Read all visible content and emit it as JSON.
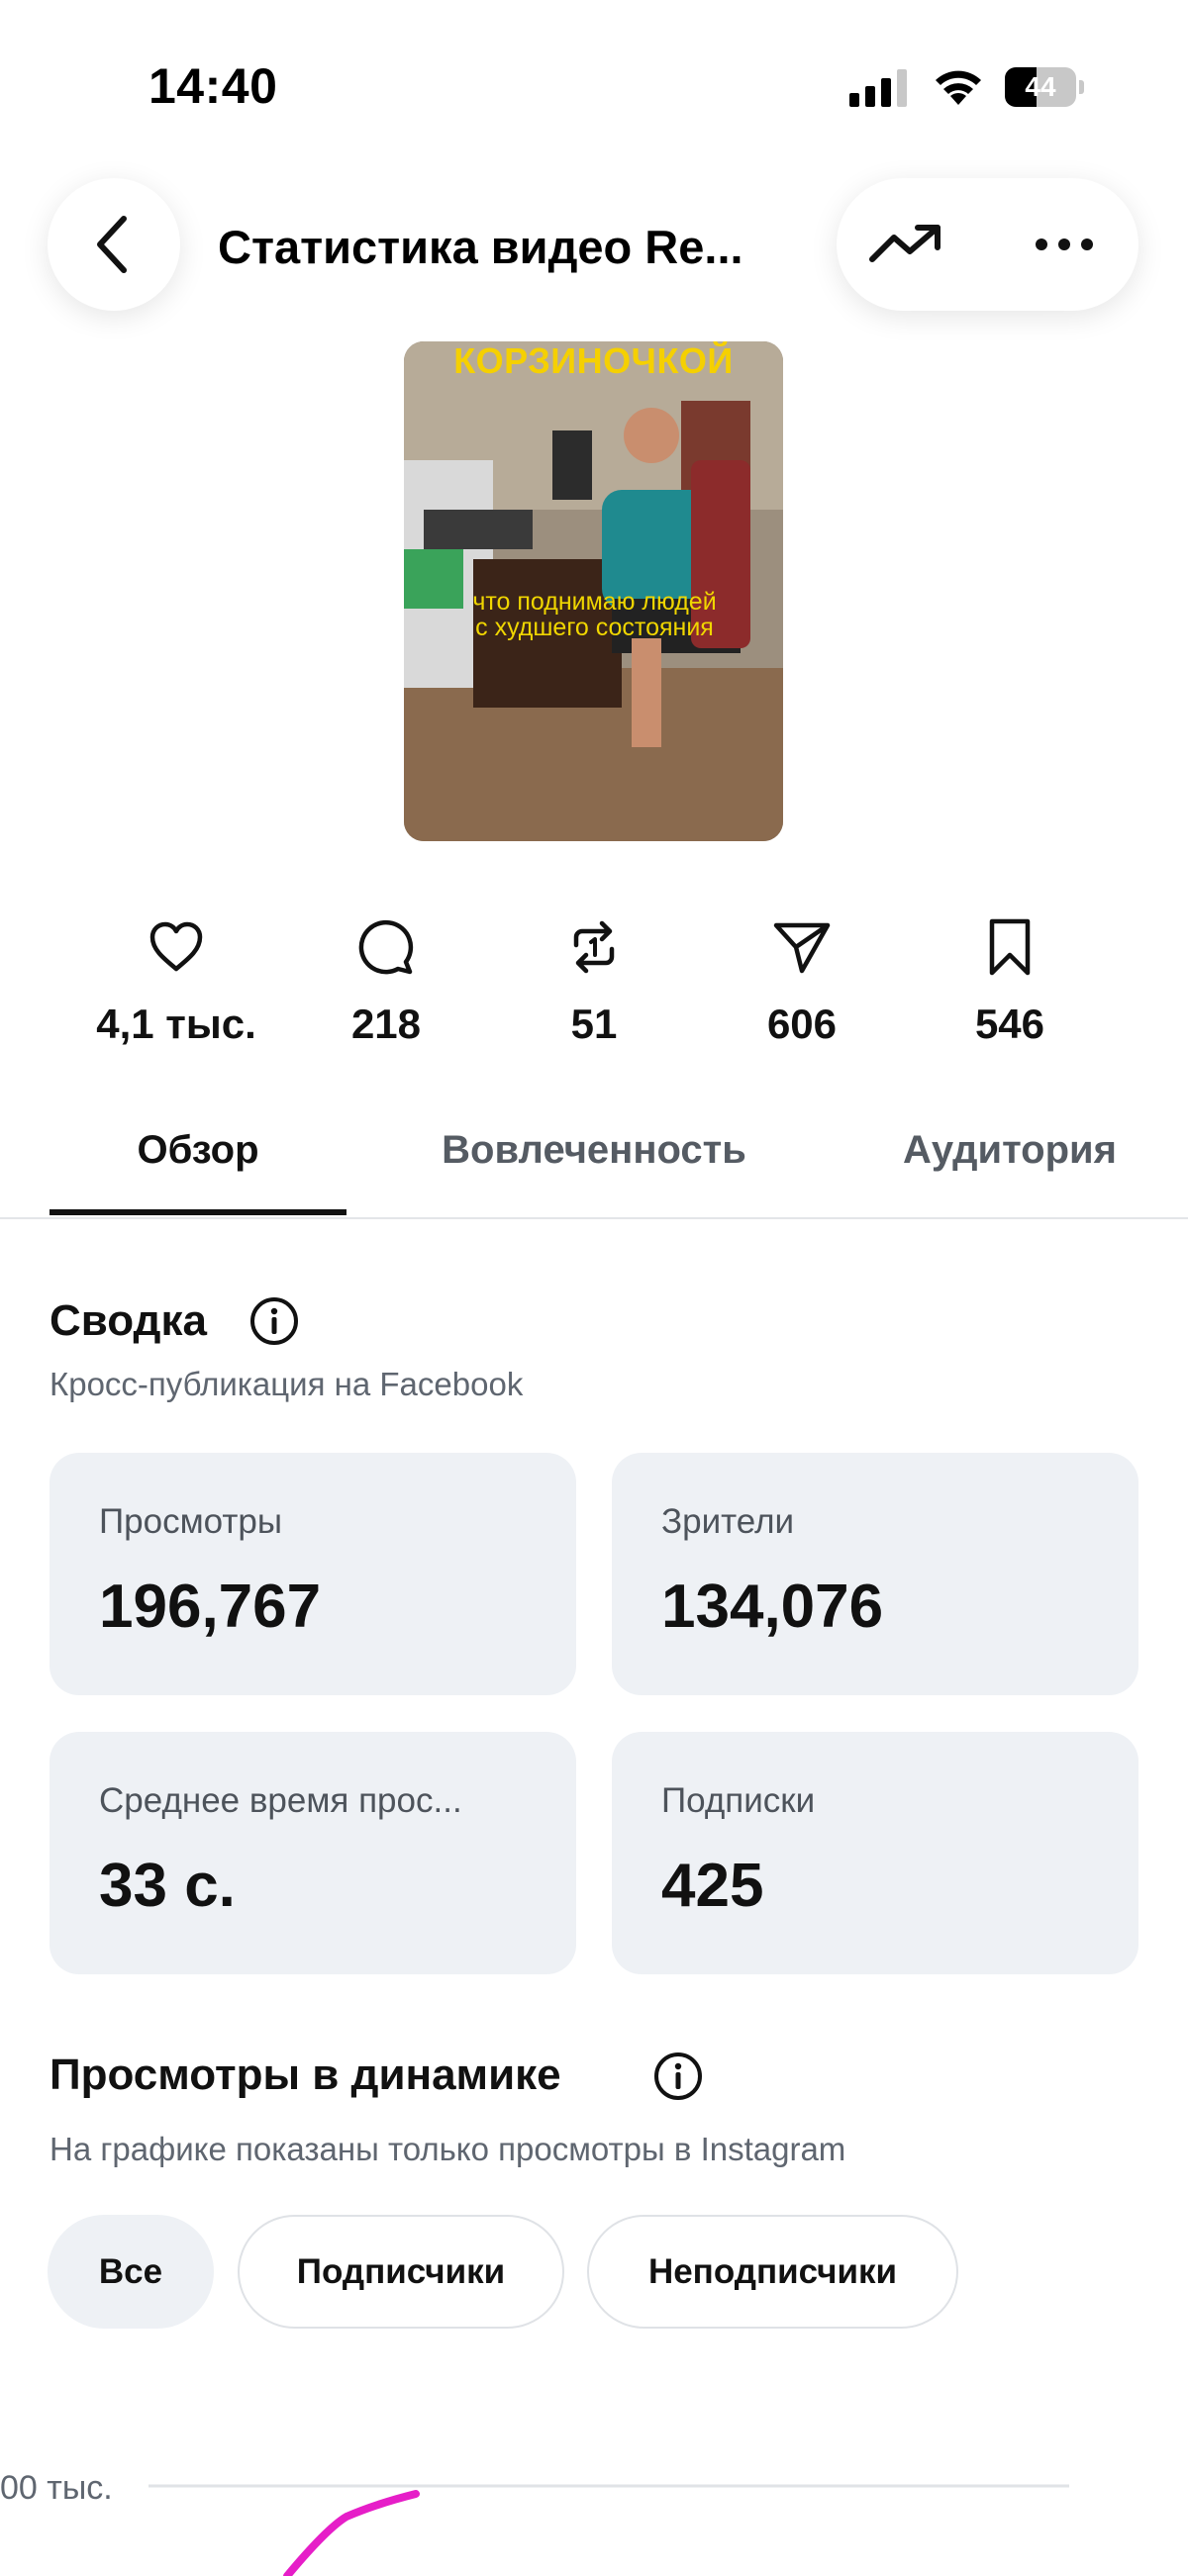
{
  "status_bar": {
    "time": "14:40",
    "battery_percent": "44",
    "battery_level": 0.44,
    "icons": [
      "cellular-signal-icon",
      "wifi-icon",
      "battery-icon"
    ]
  },
  "header": {
    "title": "Статистика видео Re...",
    "back_icon": "chevron-left-icon",
    "trend_icon": "trending-up-icon",
    "more_icon": "more-horizontal-icon"
  },
  "video": {
    "caption_top": "КОРЗИНОЧКОЙ",
    "caption_middle": "что поднимаю людей с худшего состояния"
  },
  "stats": [
    {
      "icon": "heart-icon",
      "value": "4,1 тыс."
    },
    {
      "icon": "comment-icon",
      "value": "218"
    },
    {
      "icon": "repost-icon",
      "value": "51"
    },
    {
      "icon": "send-icon",
      "value": "606"
    },
    {
      "icon": "bookmark-icon",
      "value": "546"
    }
  ],
  "tabs": [
    {
      "label": "Обзор",
      "active": true
    },
    {
      "label": "Вовлеченность",
      "active": false
    },
    {
      "label": "Аудитория",
      "active": false
    }
  ],
  "summary": {
    "title": "Сводка",
    "subtitle": "Кросс-публикация на Facebook",
    "cards": [
      {
        "label": "Просмотры",
        "value": "196,767"
      },
      {
        "label": "Зрители",
        "value": "134,076"
      },
      {
        "label": "Среднее время прос...",
        "value": "33 с."
      },
      {
        "label": "Подписки",
        "value": "425"
      }
    ]
  },
  "views_dynamics": {
    "title": "Просмотры в динамике",
    "subtitle": "На графике показаны только просмотры в Instagram",
    "filters": [
      {
        "label": "Все",
        "active": true
      },
      {
        "label": "Подписчики",
        "active": false
      },
      {
        "label": "Неподписчики",
        "active": false
      }
    ],
    "tick_label": "00 тыс."
  },
  "colors": {
    "accent_line": "#e61ec8",
    "card_bg": "#eef1f5",
    "muted_text": "#5f6670"
  }
}
